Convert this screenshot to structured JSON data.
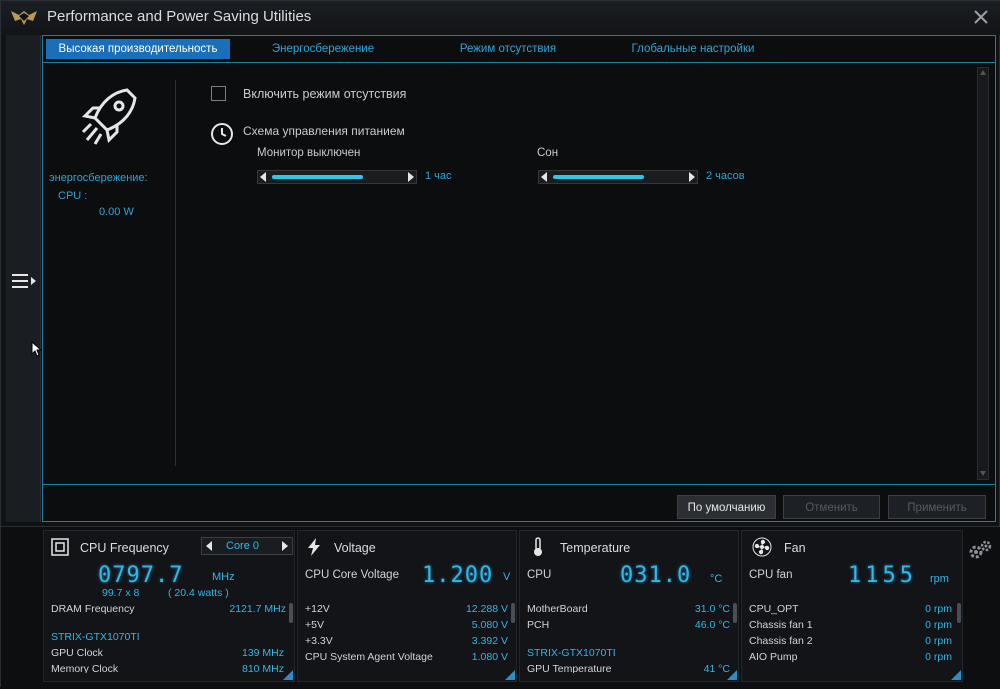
{
  "window": {
    "title": "Performance and Power Saving Utilities"
  },
  "tabs": [
    {
      "label": "Высокая производительность",
      "active": true
    },
    {
      "label": "Энергосбережение",
      "active": false
    },
    {
      "label": "Режим отсутствия",
      "active": false
    },
    {
      "label": "Глобальные настройки",
      "active": false
    }
  ],
  "left": {
    "mode_label": "энергосбережение:",
    "cpu_label": "CPU :",
    "cpu_value": "0.00 W"
  },
  "away": {
    "checkbox_label": "Включить режим отсутствия"
  },
  "power": {
    "schema_label": "Схема управления питанием",
    "monitor": {
      "label": "Монитор выключен",
      "value": "1 час",
      "fill": 0.7
    },
    "sleep": {
      "label": "Сон",
      "value": "2 часов",
      "fill": 0.7
    }
  },
  "buttons": {
    "default": "По умолчанию",
    "cancel": "Отменить",
    "apply": "Применить"
  },
  "panels": {
    "cpu": {
      "title": "CPU Frequency",
      "core": "Core 0",
      "big": "0797.7",
      "unit": "MHz",
      "ratio": "99.7   x  8",
      "watts": "( 20.4 watts )",
      "dram_label": "DRAM Frequency",
      "dram_value": "2121.7  MHz",
      "gpu_name": "STRIX-GTX1070TI",
      "gpu_clock_label": "GPU Clock",
      "gpu_clock_value": "139 MHz",
      "mem_label": "Memory Clock",
      "mem_value": "810 MHz"
    },
    "voltage": {
      "title": "Voltage",
      "main_label": "CPU Core Voltage",
      "big": "1.200",
      "unit": "V",
      "rows": [
        {
          "label": "+12V",
          "value": "12.288  V"
        },
        {
          "label": "+5V",
          "value": "5.080  V"
        },
        {
          "label": "+3.3V",
          "value": "3.392  V"
        },
        {
          "label": "CPU System Agent Voltage",
          "value": "1.080  V"
        }
      ]
    },
    "temperature": {
      "title": "Temperature",
      "main_label": "CPU",
      "big": "031.0",
      "unit": "°C",
      "rows": [
        {
          "label": "MotherBoard",
          "value": "31.0 °C"
        },
        {
          "label": "PCH",
          "value": "46.0 °C"
        }
      ],
      "gpu_name": "STRIX-GTX1070TI",
      "gpu_temp_label": "GPU Temperature",
      "gpu_temp_value": "41 °C"
    },
    "fan": {
      "title": "Fan",
      "main_label": "CPU fan",
      "big": "1155",
      "unit": "rpm",
      "rows": [
        {
          "label": "CPU_OPT",
          "value": "0  rpm"
        },
        {
          "label": "Chassis fan 1",
          "value": "0  rpm"
        },
        {
          "label": "Chassis fan 2",
          "value": "0  rpm"
        },
        {
          "label": "AIO Pump",
          "value": "0  rpm"
        }
      ]
    }
  },
  "colors": {
    "accent": "#2ea6d6",
    "active_tab": "#1a6fb8",
    "border": "#1c7fa3"
  }
}
